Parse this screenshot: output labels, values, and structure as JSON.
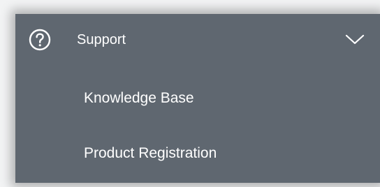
{
  "menu": {
    "title": "Support",
    "icon": "help-circle-icon",
    "expand_icon": "chevron-down-icon",
    "items": [
      {
        "label": "Knowledge Base"
      },
      {
        "label": "Product Registration"
      }
    ]
  },
  "colors": {
    "panel_background": "#5f6770",
    "text": "#ffffff",
    "page_background": "#f2f3f4"
  }
}
